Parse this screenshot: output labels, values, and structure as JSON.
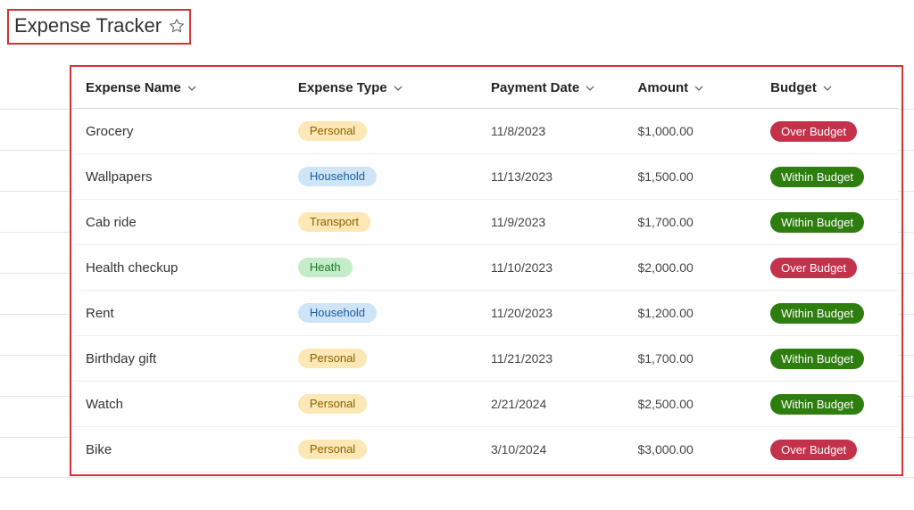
{
  "header": {
    "title": "Expense Tracker"
  },
  "columns": {
    "name": "Expense Name",
    "type": "Expense Type",
    "date": "Payment Date",
    "amount": "Amount",
    "budget": "Budget"
  },
  "type_styles": {
    "Personal": "pill-personal",
    "Household": "pill-household",
    "Transport": "pill-transport",
    "Heath": "pill-heath"
  },
  "budget_styles": {
    "Over Budget": "over",
    "Within Budget": "within"
  },
  "rows": [
    {
      "name": "Grocery",
      "type": "Personal",
      "date": "11/8/2023",
      "amount": "$1,000.00",
      "budget": "Over Budget"
    },
    {
      "name": "Wallpapers",
      "type": "Household",
      "date": "11/13/2023",
      "amount": "$1,500.00",
      "budget": "Within Budget"
    },
    {
      "name": "Cab ride",
      "type": "Transport",
      "date": "11/9/2023",
      "amount": "$1,700.00",
      "budget": "Within Budget"
    },
    {
      "name": "Health checkup",
      "type": "Heath",
      "date": "11/10/2023",
      "amount": "$2,000.00",
      "budget": "Over Budget"
    },
    {
      "name": "Rent",
      "type": "Household",
      "date": "11/20/2023",
      "amount": "$1,200.00",
      "budget": "Within Budget"
    },
    {
      "name": "Birthday gift",
      "type": "Personal",
      "date": "11/21/2023",
      "amount": "$1,700.00",
      "budget": "Within Budget"
    },
    {
      "name": "Watch",
      "type": "Personal",
      "date": "2/21/2024",
      "amount": "$2,500.00",
      "budget": "Within Budget"
    },
    {
      "name": "Bike",
      "type": "Personal",
      "date": "3/10/2024",
      "amount": "$3,000.00",
      "budget": "Over Budget"
    }
  ]
}
